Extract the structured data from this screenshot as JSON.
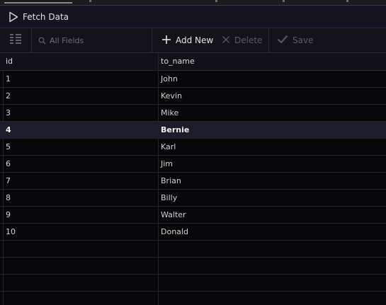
{
  "toolbar": {
    "fetch_label": "Fetch Data",
    "search_placeholder": "All Fields",
    "add_label": "Add New",
    "delete_label": "Delete",
    "save_label": "Save"
  },
  "table": {
    "columns": [
      "id",
      "to_name"
    ],
    "selected_id": "4",
    "rows": [
      {
        "id": "1",
        "to_name": "John"
      },
      {
        "id": "2",
        "to_name": "Kevin"
      },
      {
        "id": "3",
        "to_name": "Mike"
      },
      {
        "id": "4",
        "to_name": "Bernie"
      },
      {
        "id": "5",
        "to_name": "Karl"
      },
      {
        "id": "6",
        "to_name": "Jim"
      },
      {
        "id": "7",
        "to_name": "Brian"
      },
      {
        "id": "8",
        "to_name": "Billy"
      },
      {
        "id": "9",
        "to_name": "Walter"
      },
      {
        "id": "10",
        "to_name": "Donald"
      }
    ]
  },
  "colors": {
    "background": "#070609",
    "toolbar_bg": "#141319",
    "selected_row": "#1d1c2a",
    "disabled_text": "#5b5b60"
  },
  "icons": {
    "fetch": "play-icon",
    "grid_toggle": "columns-icon",
    "search": "search-icon",
    "add": "plus-icon",
    "delete": "close-icon",
    "save": "check-icon"
  }
}
